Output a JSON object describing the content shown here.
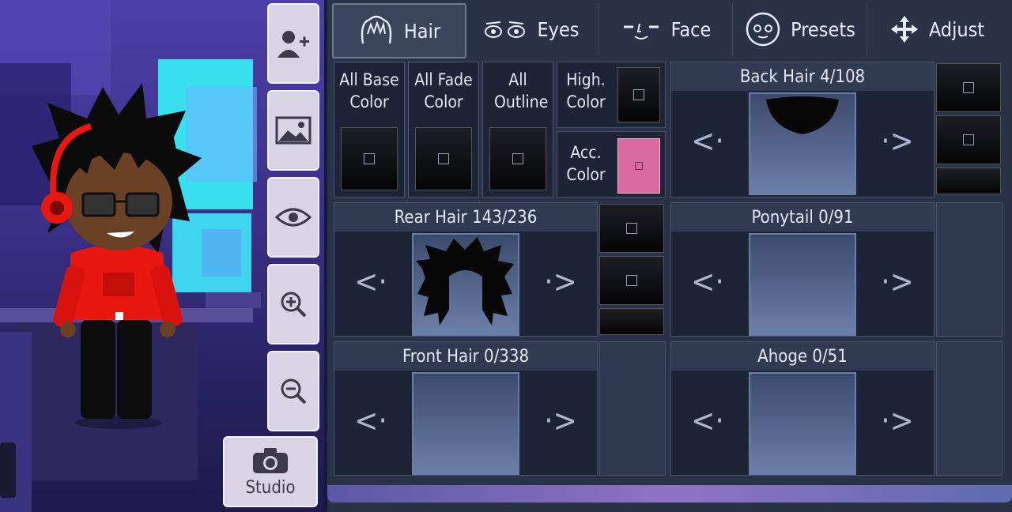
{
  "tabs": [
    {
      "label": "Hair",
      "icon": "hair-icon",
      "active": true
    },
    {
      "label": "Eyes",
      "icon": "eyes-icon",
      "active": false
    },
    {
      "label": "Face",
      "icon": "face-icon",
      "active": false
    },
    {
      "label": "Presets",
      "icon": "presets-face-icon",
      "active": false
    },
    {
      "label": "Adjust",
      "icon": "move-arrows-icon",
      "active": false
    }
  ],
  "colors": {
    "all_base": "All Base Color",
    "all_fade": "All Fade Color",
    "all_outline": "All Outline",
    "high": "High. Color",
    "acc": "Acc. Color",
    "acc_swatch": "#d86a9e"
  },
  "parts": {
    "back_hair": "Back Hair 4/108",
    "rear_hair": "Rear Hair 143/236",
    "ponytail": "Ponytail 0/91",
    "front_hair": "Front Hair 0/338",
    "ahoge": "Ahoge 0/51"
  },
  "side_buttons": [
    "add-character-icon",
    "background-image-icon",
    "eye-icon",
    "zoom-in-icon",
    "zoom-out-icon"
  ],
  "studio_label": "Studio"
}
